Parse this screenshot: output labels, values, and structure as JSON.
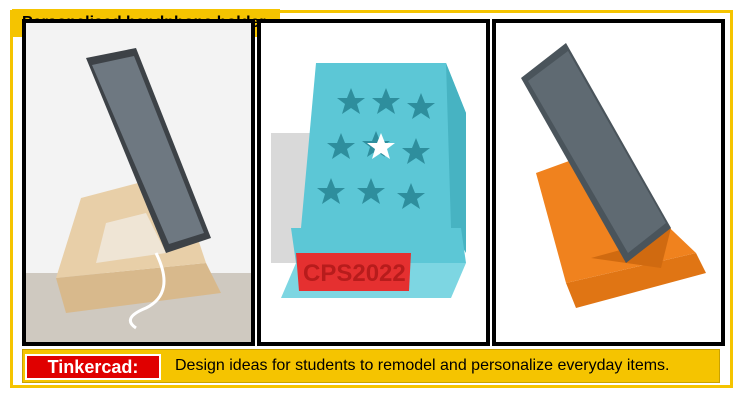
{
  "title": "Personalised handphone holder",
  "panels": [
    {
      "name": "photo-wooden-holder-with-phone"
    },
    {
      "name": "tinkercad-render-star-holder",
      "embossed_text": "CPS2022"
    },
    {
      "name": "render-orange-holder-with-phone"
    }
  ],
  "caption": {
    "badge": "Tinkercad:",
    "text": "Design ideas for students to remodel and personalize everyday items."
  },
  "colors": {
    "accent_yellow": "#f5c400",
    "badge_red": "#e00000",
    "star_holder_blue": "#5cc7d6",
    "text_red": "#e53030",
    "orange_holder": "#f0821e",
    "phone_grey": "#5f6a72",
    "wood": "#e8cfa8"
  }
}
